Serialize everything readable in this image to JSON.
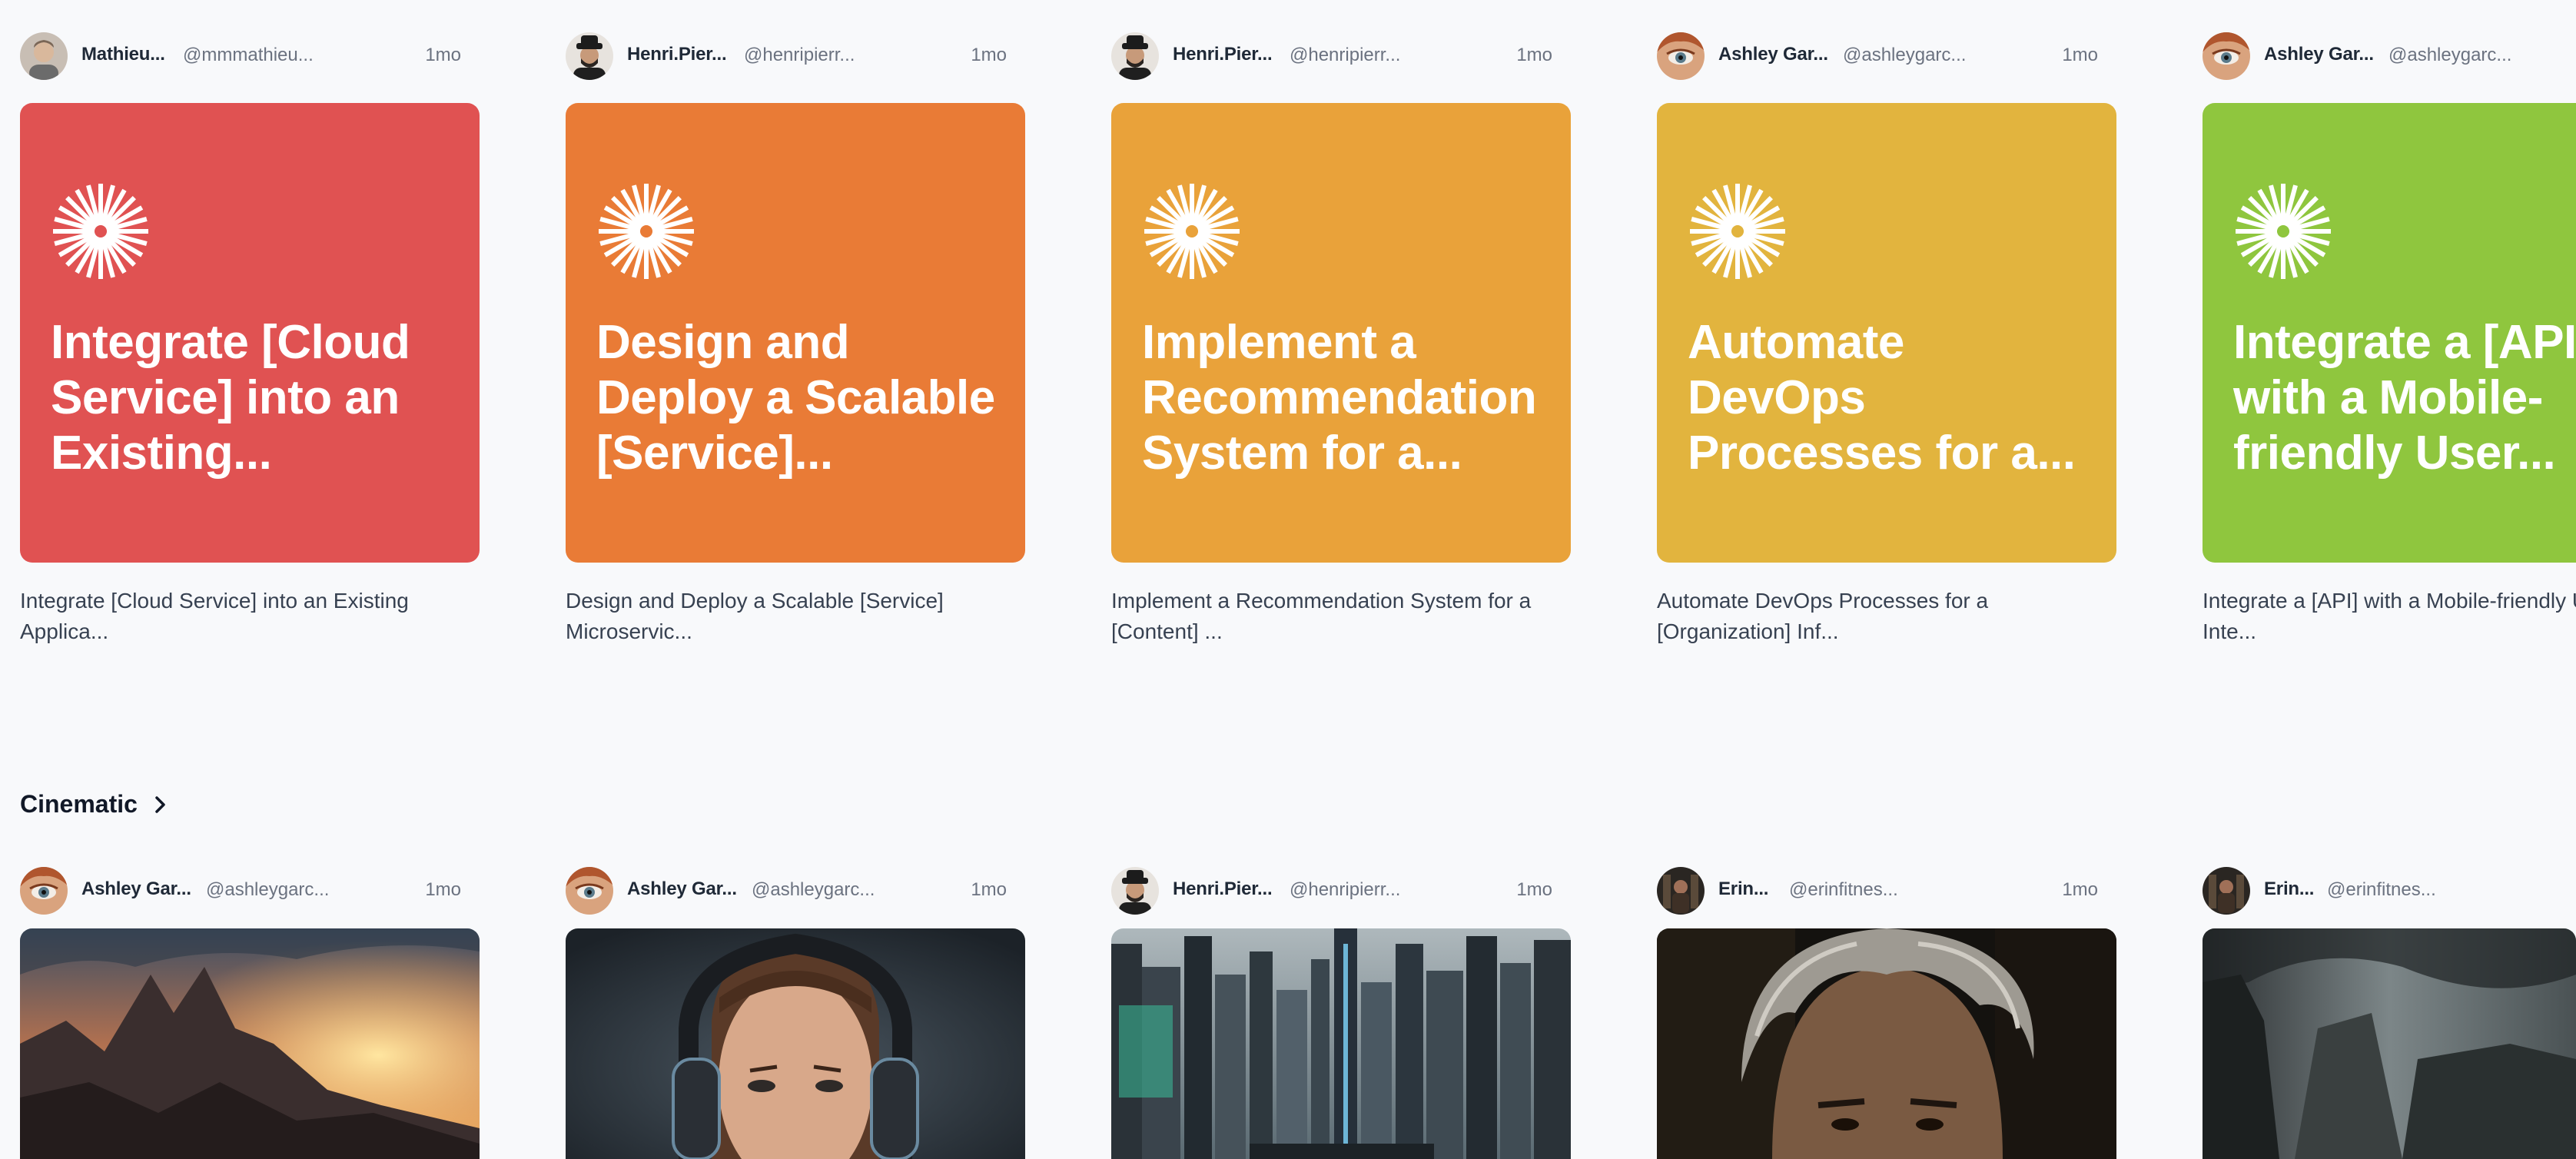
{
  "prompt_cards": [
    {
      "author": "Mathieu...",
      "handle": "@mmmathieu...",
      "time": "1mo",
      "color": "#e05252",
      "title": "Integrate [Cloud\nService] into an\nExisting...",
      "description": "Integrate [Cloud Service] into an Existing\nApplica..."
    },
    {
      "author": "Henri.Pier...",
      "handle": "@henripierr...",
      "time": "1mo",
      "color": "#e97b36",
      "title": "Design and\nDeploy a Scalable\n[Service]...",
      "description": "Design and Deploy a Scalable [Service]\nMicroservic..."
    },
    {
      "author": "Henri.Pier...",
      "handle": "@henripierr...",
      "time": "1mo",
      "color": "#e9a23a",
      "title": "Implement a\nRecommendation\nSystem for a...",
      "description": "Implement a Recommendation System for a\n[Content] ..."
    },
    {
      "author": "Ashley Gar...",
      "handle": "@ashleygarc...",
      "time": "1mo",
      "color": "#e2b43e",
      "title": "Automate\nDevOps\nProcesses for a...",
      "description": "Automate DevOps Processes for a\n[Organization] Inf..."
    },
    {
      "author": "Ashley Gar...",
      "handle": "@ashleygarc...",
      "time": "",
      "color": "#8fc63e",
      "title": "Integrate a [API]\nwith a Mobile-\nfriendly User...",
      "description": "Integrate a [API] with a Mobile-friendly User\nInte..."
    }
  ],
  "section": {
    "title": "Cinematic",
    "chevron_icon": "chevron-right-icon"
  },
  "image_cards": [
    {
      "author": "Ashley Gar...",
      "handle": "@ashleygarc...",
      "time": "1mo",
      "image": "mountain-sunset"
    },
    {
      "author": "Ashley Gar...",
      "handle": "@ashleygarc...",
      "time": "1mo",
      "image": "woman-headphones"
    },
    {
      "author": "Henri.Pier...",
      "handle": "@henripierr...",
      "time": "1mo",
      "image": "futuristic-city"
    },
    {
      "author": "Erin...",
      "handle": "@erinfitnes...",
      "time": "1mo",
      "image": "grey-haired-man"
    },
    {
      "author": "Erin...",
      "handle": "@erinfitnes...",
      "time": "",
      "image": "stormy-cliffs"
    }
  ]
}
